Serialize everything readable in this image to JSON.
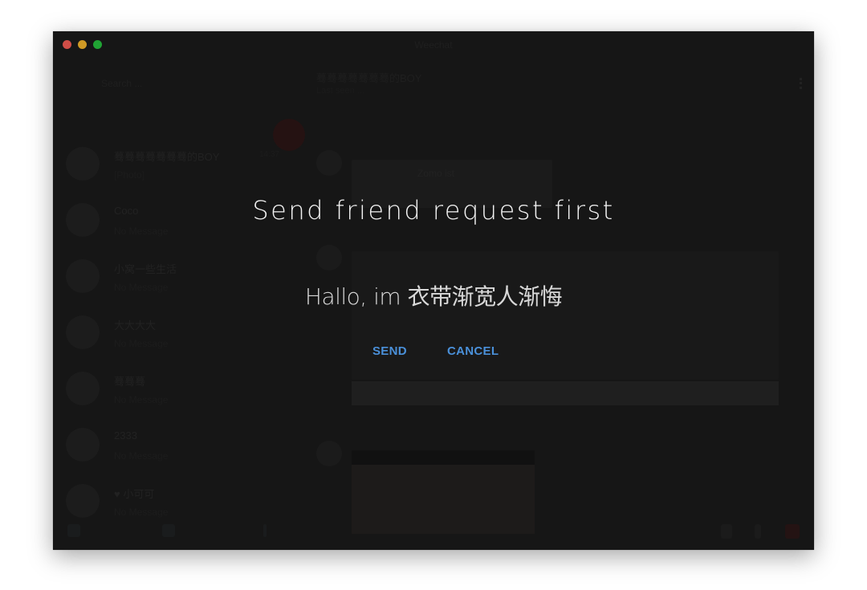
{
  "window": {
    "title": "Weechat"
  },
  "sidebar": {
    "search_placeholder": "Search ...",
    "chats": [
      {
        "name": "蓦蓦蓦蓦蓦蓦蓦的BOY",
        "message": "[Photo]",
        "time": "14:37"
      },
      {
        "name": "Coco",
        "message": "No Message",
        "time": ""
      },
      {
        "name": "小窝一些生活",
        "message": "No Message",
        "time": ""
      },
      {
        "name": "大大大大",
        "message": "No Message",
        "time": ""
      },
      {
        "name": "蓦蓦蓦",
        "message": "No Message",
        "time": ""
      },
      {
        "name": "2333",
        "message": "No Message",
        "time": ""
      },
      {
        "name": "♥ 小可可",
        "message": "No Message",
        "time": ""
      }
    ]
  },
  "conversation": {
    "title": "蓦蓦蓦蓦蓦蓦蓦的BOY",
    "subtitle": "Last seen ...",
    "contact_card_name": "Zomo ist"
  },
  "dialog": {
    "title": "Send friend request first",
    "message": "Hallo, im 衣带渐宽人渐悔",
    "send_label": "SEND",
    "cancel_label": "CANCEL"
  },
  "colors": {
    "accent": "#4a90d9",
    "window_bg": "#1b1b1b"
  }
}
